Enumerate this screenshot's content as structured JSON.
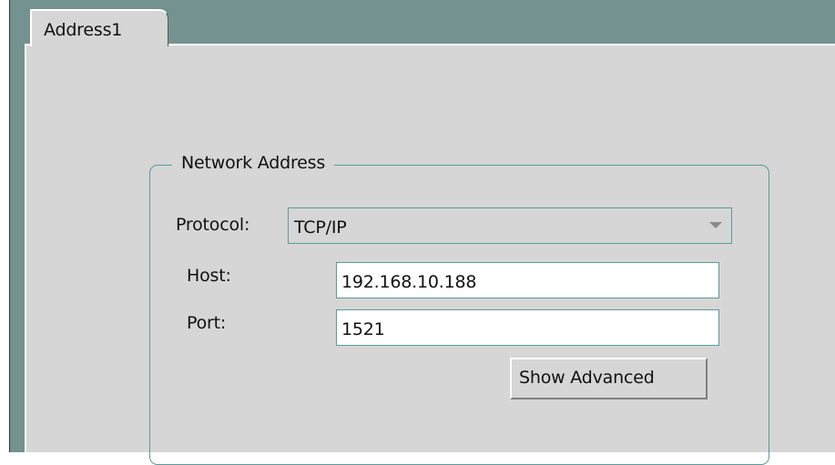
{
  "tab": {
    "label": "Address1"
  },
  "network_address": {
    "title": "Network Address",
    "protocol_label": "Protocol:",
    "protocol_value": "TCP/IP",
    "host_label": "Host:",
    "host_value": "192.168.10.188",
    "port_label": "Port:",
    "port_value": "1521",
    "show_advanced_label": "Show Advanced"
  },
  "colors": {
    "frame": "#74928f",
    "panel": "#d6d6d6",
    "border_accent": "#5b9a9a",
    "text": "#111111"
  },
  "icons": {
    "select_arrow": "chevron-down-icon"
  }
}
